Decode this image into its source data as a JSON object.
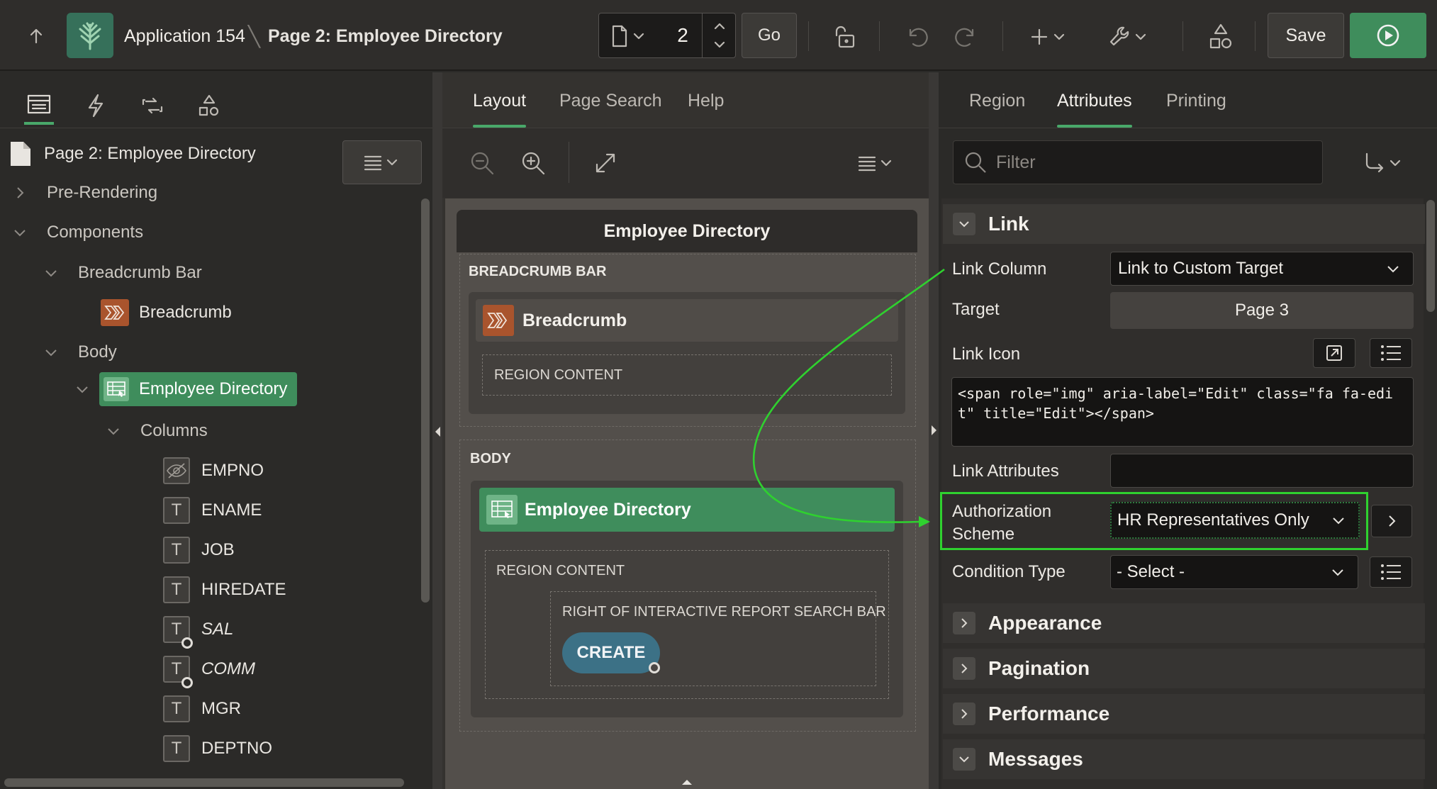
{
  "topbar": {
    "app_name": "Application 154",
    "page_name": "Page 2: Employee Directory",
    "page_number": "2",
    "go_label": "Go",
    "save_label": "Save"
  },
  "left": {
    "page_title": "Page 2: Employee Directory",
    "pre_rendering": "Pre-Rendering",
    "components": "Components",
    "breadcrumb_bar": "Breadcrumb Bar",
    "breadcrumb": "Breadcrumb",
    "body": "Body",
    "employee_directory": "Employee Directory",
    "columns": "Columns",
    "column_items": [
      "EMPNO",
      "ENAME",
      "JOB",
      "HIREDATE",
      "SAL",
      "COMM",
      "MGR",
      "DEPTNO"
    ]
  },
  "middle": {
    "tabs": [
      "Layout",
      "Page Search",
      "Help"
    ],
    "canvas_title": "Employee Directory",
    "breadcrumb_bar_label": "BREADCRUMB BAR",
    "breadcrumb_region": "Breadcrumb",
    "region_content": "REGION CONTENT",
    "body_label": "BODY",
    "employee_region": "Employee Directory",
    "region_content_2": "REGION CONTENT",
    "right_of_search": "RIGHT OF INTERACTIVE REPORT SEARCH BAR",
    "create_button": "CREATE"
  },
  "right": {
    "tabs": [
      "Region",
      "Attributes",
      "Printing"
    ],
    "filter_placeholder": "Filter",
    "link_section": "Link",
    "link_column_label": "Link Column",
    "link_column_value": "Link to Custom Target",
    "target_label": "Target",
    "target_value": "Page 3",
    "link_icon_label": "Link Icon",
    "link_icon_code": "<span role=\"img\" aria-label=\"Edit\" class=\"fa fa-edit\" title=\"Edit\"></span>",
    "link_attributes_label": "Link Attributes",
    "authorization_label_1": "Authorization",
    "authorization_label_2": "Scheme",
    "authorization_value": "HR Representatives Only",
    "condition_type_label": "Condition Type",
    "condition_type_value": "- Select -",
    "sections": [
      "Appearance",
      "Pagination",
      "Performance",
      "Messages"
    ]
  },
  "colors": {
    "accent_green": "#3f8d5c",
    "highlight_green": "#2fd12f",
    "breadcrumb_orange": "#a9542d",
    "create_teal": "#3c7186"
  }
}
